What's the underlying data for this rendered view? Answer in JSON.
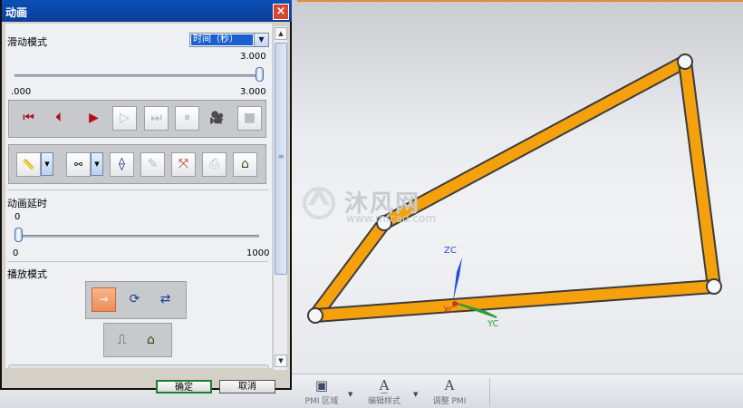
{
  "dialog": {
    "title": "动画",
    "close_icon": "×",
    "slide_mode": {
      "label": "滑动模式",
      "selected": "时间（秒）",
      "current_value": "3.000",
      "range_min": ".000",
      "range_max": "3.000",
      "position": 1.0
    },
    "playback_buttons": [
      "skip-to-start",
      "step-back",
      "play",
      "step-forward",
      "skip-to-end",
      "pause",
      "record-camera",
      "stop"
    ],
    "tool_buttons": [
      "measure",
      "interference",
      "trace",
      "explode",
      "track-hidden",
      "capture",
      "export-package"
    ],
    "delay": {
      "label": "动画延时",
      "value": "0",
      "min": "0",
      "max": "1000",
      "position": 0.0
    },
    "play_mode": {
      "label": "播放模式",
      "options": [
        "play-once",
        "loop",
        "back-and-forth"
      ],
      "selected": "play-once"
    },
    "footer": {
      "ok": "确定",
      "cancel": "取消"
    }
  },
  "viewport": {
    "axes": {
      "zc": "ZC",
      "yc": "YC",
      "xc": "XC"
    },
    "watermark": "沐风网",
    "watermark_url": "www.mfcad.com",
    "linkage_color": "#f5a10d"
  },
  "bottom_toolbar": {
    "items": [
      {
        "label": "PMI 区域",
        "icon": "pmi-region-icon"
      },
      {
        "label": "编辑样式",
        "icon": "edit-style-icon"
      },
      {
        "label": "调整 PMI",
        "icon": "adjust-pmi-icon"
      }
    ]
  }
}
